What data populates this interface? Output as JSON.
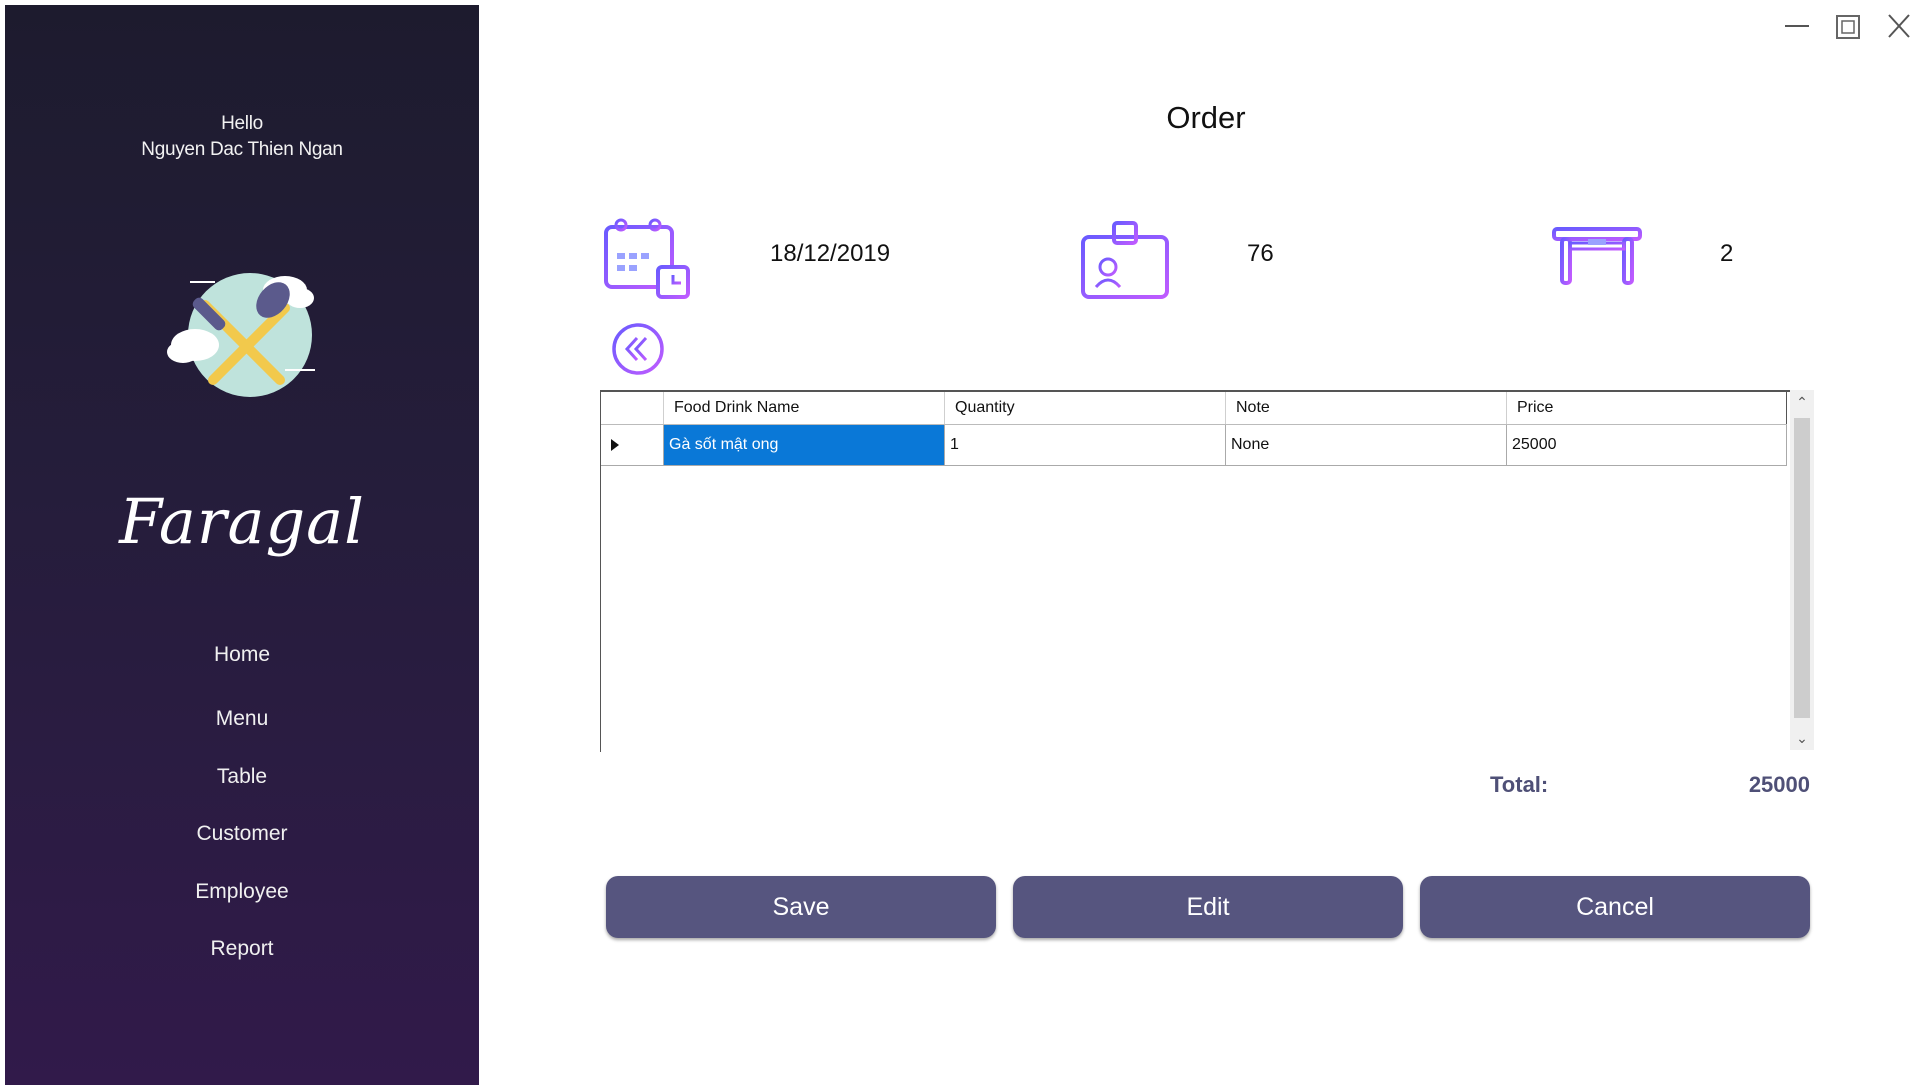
{
  "sidebar": {
    "greeting": "Hello",
    "user_name": "Nguyen Dac Thien Ngan",
    "brand": "Faragal",
    "nav": [
      {
        "label": "Home"
      },
      {
        "label": "Menu"
      },
      {
        "label": "Table"
      },
      {
        "label": "Customer"
      },
      {
        "label": "Employee"
      },
      {
        "label": "Report"
      }
    ]
  },
  "page": {
    "title": "Order"
  },
  "info": {
    "date": "18/12/2019",
    "employee_id": "76",
    "table_no": "2"
  },
  "grid": {
    "columns": [
      "Food Drink Name",
      "Quantity",
      "Note",
      "Price"
    ],
    "rows": [
      {
        "name": "Gà sốt mật ong",
        "quantity": "1",
        "note": "None",
        "price": "25000"
      }
    ]
  },
  "summary": {
    "total_label": "Total:",
    "total_value": "25000"
  },
  "actions": {
    "save": "Save",
    "edit": "Edit",
    "cancel": "Cancel"
  },
  "colors": {
    "sidebar_top": "#1d1b2e",
    "sidebar_bottom": "#311a4a",
    "button": "#56557f",
    "selection": "#0a78d7",
    "icon_gradient_start": "#6a5bff",
    "icon_gradient_end": "#c05bff"
  }
}
